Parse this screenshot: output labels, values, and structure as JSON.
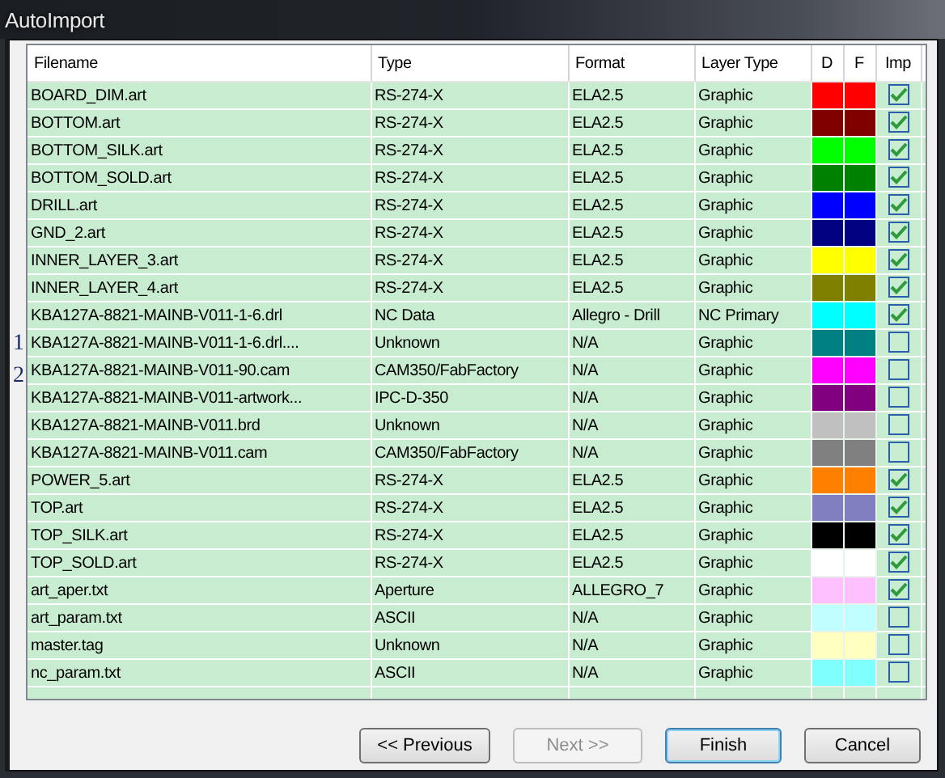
{
  "window": {
    "title": "AutoImport"
  },
  "background_marks": [
    "1",
    "2"
  ],
  "table": {
    "columns": [
      "Filename",
      "Type",
      "Format",
      "Layer Type",
      "D",
      "F",
      "Imp"
    ],
    "rows": [
      {
        "filename": "BOARD_DIM.art",
        "type": "RS-274-X",
        "format": "ELA2.5",
        "layer_type": "Graphic",
        "color": "#ff0000",
        "checked": true
      },
      {
        "filename": "BOTTOM.art",
        "type": "RS-274-X",
        "format": "ELA2.5",
        "layer_type": "Graphic",
        "color": "#800000",
        "checked": true
      },
      {
        "filename": "BOTTOM_SILK.art",
        "type": "RS-274-X",
        "format": "ELA2.5",
        "layer_type": "Graphic",
        "color": "#00ff00",
        "checked": true
      },
      {
        "filename": "BOTTOM_SOLD.art",
        "type": "RS-274-X",
        "format": "ELA2.5",
        "layer_type": "Graphic",
        "color": "#008000",
        "checked": true
      },
      {
        "filename": "DRILL.art",
        "type": "RS-274-X",
        "format": "ELA2.5",
        "layer_type": "Graphic",
        "color": "#0000ff",
        "checked": true
      },
      {
        "filename": "GND_2.art",
        "type": "RS-274-X",
        "format": "ELA2.5",
        "layer_type": "Graphic",
        "color": "#000080",
        "checked": true
      },
      {
        "filename": "INNER_LAYER_3.art",
        "type": "RS-274-X",
        "format": "ELA2.5",
        "layer_type": "Graphic",
        "color": "#ffff00",
        "checked": true
      },
      {
        "filename": "INNER_LAYER_4.art",
        "type": "RS-274-X",
        "format": "ELA2.5",
        "layer_type": "Graphic",
        "color": "#808000",
        "checked": true
      },
      {
        "filename": "KBA127A-8821-MAINB-V011-1-6.drl",
        "type": "NC Data",
        "format": "Allegro - Drill",
        "layer_type": "NC Primary",
        "color": "#00ffff",
        "checked": true
      },
      {
        "filename": "KBA127A-8821-MAINB-V011-1-6.drl....",
        "type": "Unknown",
        "format": "N/A",
        "layer_type": "Graphic",
        "color": "#008080",
        "checked": false
      },
      {
        "filename": "KBA127A-8821-MAINB-V011-90.cam",
        "type": "CAM350/FabFactory",
        "format": "N/A",
        "layer_type": "Graphic",
        "color": "#ff00ff",
        "checked": false
      },
      {
        "filename": "KBA127A-8821-MAINB-V011-artwork...",
        "type": "IPC-D-350",
        "format": "N/A",
        "layer_type": "Graphic",
        "color": "#800080",
        "checked": false
      },
      {
        "filename": "KBA127A-8821-MAINB-V011.brd",
        "type": "Unknown",
        "format": "N/A",
        "layer_type": "Graphic",
        "color": "#c0c0c0",
        "checked": false
      },
      {
        "filename": "KBA127A-8821-MAINB-V011.cam",
        "type": "CAM350/FabFactory",
        "format": "N/A",
        "layer_type": "Graphic",
        "color": "#808080",
        "checked": false
      },
      {
        "filename": "POWER_5.art",
        "type": "RS-274-X",
        "format": "ELA2.5",
        "layer_type": "Graphic",
        "color": "#ff8000",
        "checked": true
      },
      {
        "filename": "TOP.art",
        "type": "RS-274-X",
        "format": "ELA2.5",
        "layer_type": "Graphic",
        "color": "#8080c0",
        "checked": true
      },
      {
        "filename": "TOP_SILK.art",
        "type": "RS-274-X",
        "format": "ELA2.5",
        "layer_type": "Graphic",
        "color": "#000000",
        "checked": true
      },
      {
        "filename": "TOP_SOLD.art",
        "type": "RS-274-X",
        "format": "ELA2.5",
        "layer_type": "Graphic",
        "color": "#ffffff",
        "checked": true
      },
      {
        "filename": "art_aper.txt",
        "type": "Aperture",
        "format": "ALLEGRO_7",
        "layer_type": "Graphic",
        "color": "#ffc0ff",
        "checked": true
      },
      {
        "filename": "art_param.txt",
        "type": "ASCII",
        "format": "N/A",
        "layer_type": "Graphic",
        "color": "#c0ffff",
        "checked": false
      },
      {
        "filename": "master.tag",
        "type": "Unknown",
        "format": "N/A",
        "layer_type": "Graphic",
        "color": "#ffffc0",
        "checked": false
      },
      {
        "filename": "nc_param.txt",
        "type": "ASCII",
        "format": "N/A",
        "layer_type": "Graphic",
        "color": "#80ffff",
        "checked": false
      }
    ]
  },
  "buttons": [
    {
      "label": "<< Previous",
      "disabled": false,
      "focused": false
    },
    {
      "label": "Next >>",
      "disabled": true,
      "focused": false
    },
    {
      "label": "Finish",
      "disabled": false,
      "focused": true
    },
    {
      "label": "Cancel",
      "disabled": false,
      "focused": false
    }
  ]
}
